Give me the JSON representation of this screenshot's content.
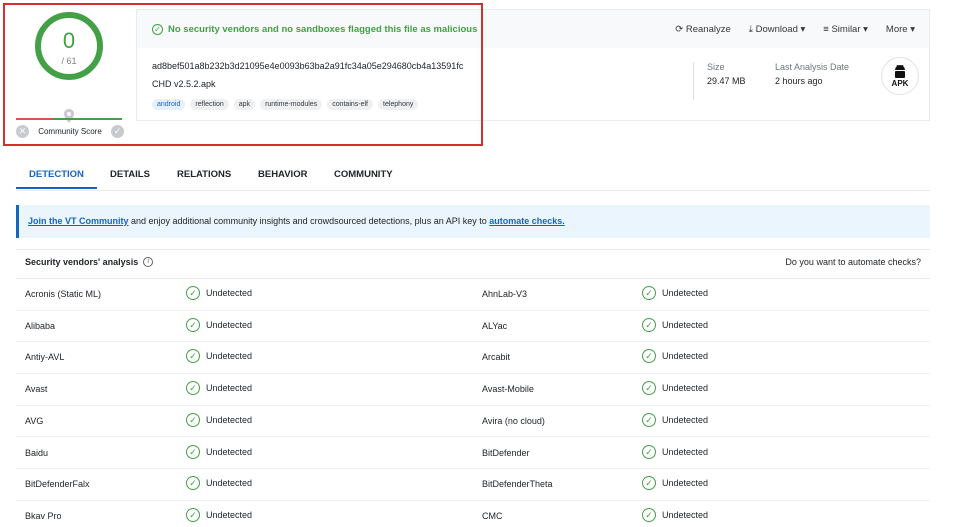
{
  "score": {
    "detections": "0",
    "total": "/ 61",
    "community_label": "Community Score"
  },
  "banner": {
    "message": "No security vendors and no sandboxes flagged this file as malicious"
  },
  "actions": [
    "Reanalyze",
    "Download",
    "Similar",
    "More"
  ],
  "file": {
    "hash": "ad8bef501a8b232b3d21095e4e0093b63ba2a91fc34a05e294680cb4a13591fc",
    "name": "CHD v2.5.2.apk",
    "tags": [
      "android",
      "reflection",
      "apk",
      "runtime-modules",
      "contains-elf",
      "telephony"
    ],
    "size_label": "Size",
    "size_value": "29.47 MB",
    "last_label": "Last Analysis Date",
    "last_value": "2 hours ago",
    "type_label": "APK"
  },
  "tabs": [
    "DETECTION",
    "DETAILS",
    "RELATIONS",
    "BEHAVIOR",
    "COMMUNITY"
  ],
  "vt_banner": {
    "link1": "Join the VT Community",
    "text": " and enjoy additional community insights and crowdsourced detections, plus an API key to ",
    "link2": "automate checks."
  },
  "vendors_header": {
    "title": "Security vendors' analysis",
    "right": "Do you want to automate checks?"
  },
  "vendors": [
    {
      "left": "Acronis (Static ML)",
      "left_result": "Undetected",
      "right": "AhnLab-V3",
      "right_result": "Undetected"
    },
    {
      "left": "Alibaba",
      "left_result": "Undetected",
      "right": "ALYac",
      "right_result": "Undetected"
    },
    {
      "left": "Antiy-AVL",
      "left_result": "Undetected",
      "right": "Arcabit",
      "right_result": "Undetected"
    },
    {
      "left": "Avast",
      "left_result": "Undetected",
      "right": "Avast-Mobile",
      "right_result": "Undetected"
    },
    {
      "left": "AVG",
      "left_result": "Undetected",
      "right": "Avira (no cloud)",
      "right_result": "Undetected"
    },
    {
      "left": "Baidu",
      "left_result": "Undetected",
      "right": "BitDefender",
      "right_result": "Undetected"
    },
    {
      "left": "BitDefenderFalx",
      "left_result": "Undetected",
      "right": "BitDefenderTheta",
      "right_result": "Undetected"
    },
    {
      "left": "Bkav Pro",
      "left_result": "Undetected",
      "right": "CMC",
      "right_result": "Undetected"
    }
  ],
  "colors": {
    "clean": "#43a047",
    "accent": "#1565c0",
    "highlight": "#d32f2f"
  }
}
